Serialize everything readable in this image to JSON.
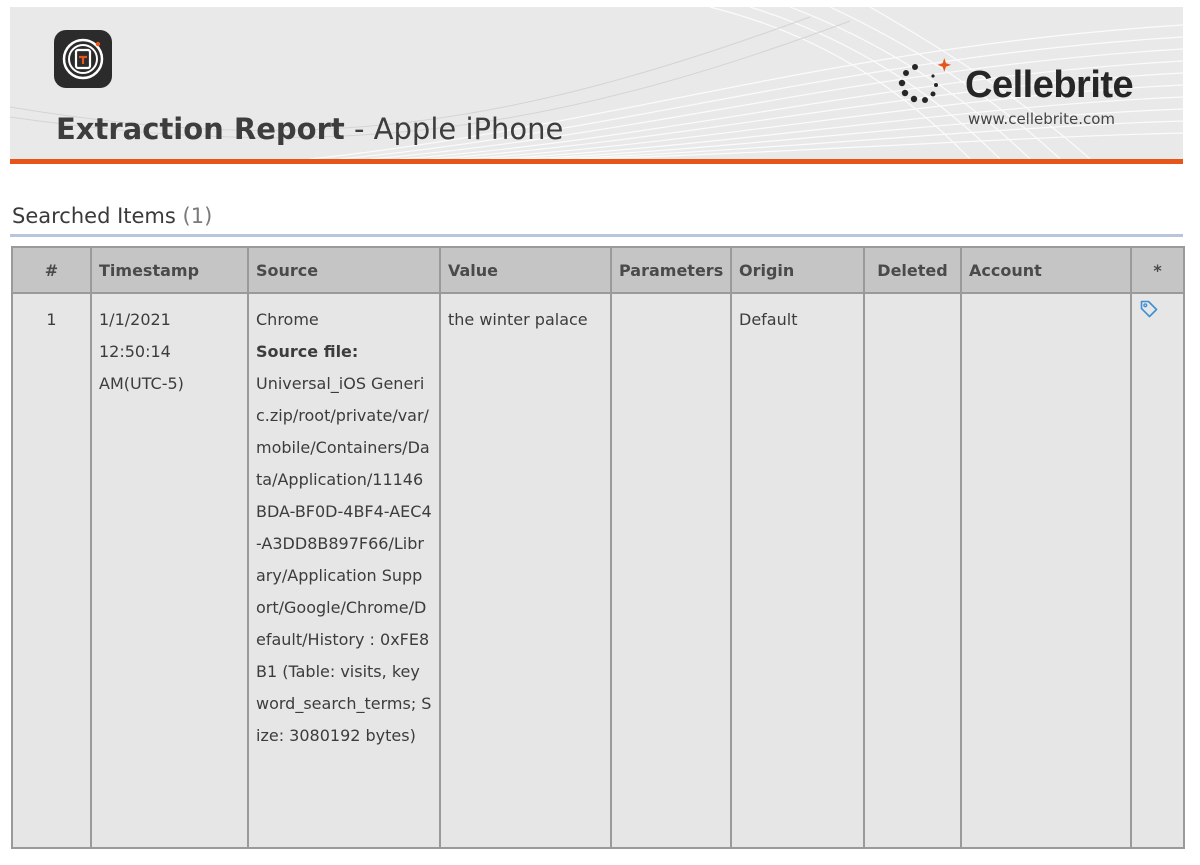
{
  "header": {
    "title_strong": "Extraction Report",
    "title_sep": " - ",
    "title_device": "Apple iPhone",
    "brand_name": "Cellebrite",
    "brand_url": "www.cellebrite.com",
    "accent_color": "#e8551a"
  },
  "section": {
    "title": "Searched Items",
    "count": "(1)"
  },
  "table": {
    "columns": {
      "num": "#",
      "timestamp": "Timestamp",
      "source": "Source",
      "value": "Value",
      "parameters": "Parameters",
      "origin": "Origin",
      "deleted": "Deleted",
      "account": "Account",
      "star": "*"
    },
    "rows": [
      {
        "num": "1",
        "timestamp": "1/1/2021 12:50:14 AM(UTC-5)",
        "source_app": "Chrome",
        "source_file_label": "Source file:",
        "source_file": "Universal_iOS Generic.zip/root/private/var/mobile/Containers/Data/Application/11146BDA-BF0D-4BF4-AEC4-A3DD8B897F66/Library/Application Support/Google/Chrome/Default/History : 0xFE8B1 (Table: visits, keyword_search_terms; Size: 3080192 bytes)",
        "value": "the winter palace",
        "parameters": "",
        "origin": "Default",
        "deleted": "",
        "account": "",
        "tag_icon": "tag-icon"
      }
    ]
  }
}
